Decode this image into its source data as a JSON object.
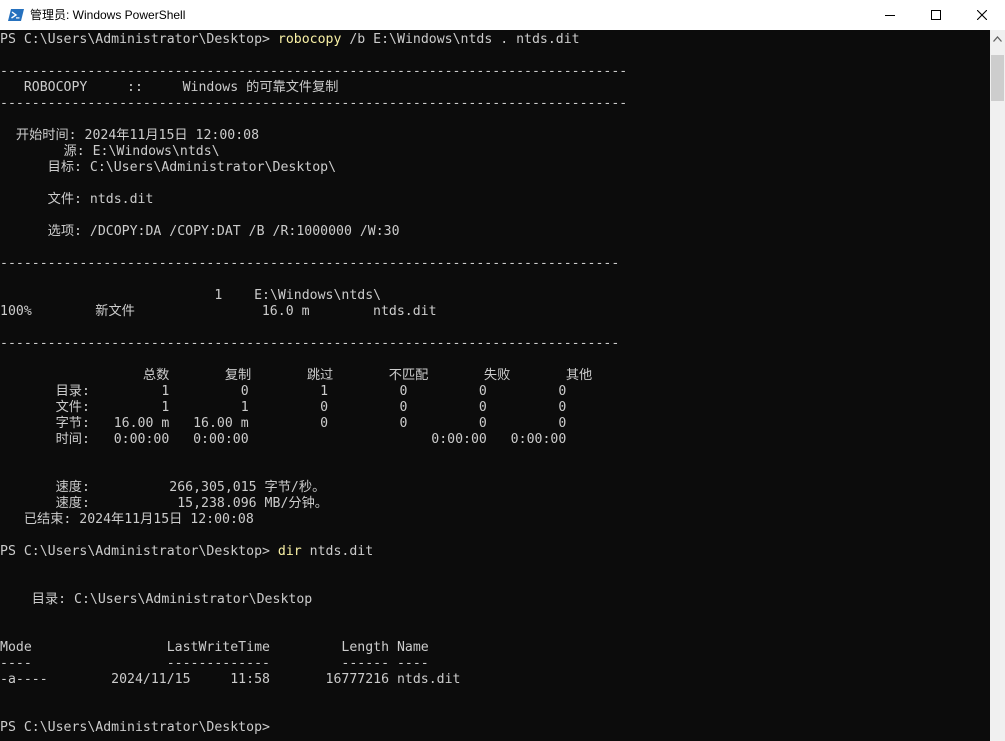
{
  "window": {
    "title": "管理员: Windows PowerShell"
  },
  "icons": {
    "app": "powershell-icon",
    "minimize": "minimize-icon",
    "maximize": "maximize-icon",
    "close": "close-icon",
    "scroll_up": "chevron-up-icon"
  },
  "colors": {
    "console_bg": "#0c0c0c",
    "console_text": "#cccccc",
    "command_text": "#f9f1a5",
    "powershell_blue": "#012456"
  },
  "console": {
    "lines": [
      {
        "prompt": "PS C:\\Users\\Administrator\\Desktop> ",
        "cmd": "robocopy",
        "rest": " /b E:\\Windows\\ntds . ntds.dit"
      },
      {
        "text": ""
      },
      {
        "text": "-------------------------------------------------------------------------------"
      },
      {
        "text": "   ROBOCOPY     ::     Windows 的可靠文件复制"
      },
      {
        "text": "-------------------------------------------------------------------------------"
      },
      {
        "text": ""
      },
      {
        "text": "  开始时间: 2024年11月15日 12:00:08"
      },
      {
        "text": "        源: E:\\Windows\\ntds\\"
      },
      {
        "text": "      目标: C:\\Users\\Administrator\\Desktop\\"
      },
      {
        "text": ""
      },
      {
        "text": "      文件: ntds.dit"
      },
      {
        "text": ""
      },
      {
        "text": "      选项: /DCOPY:DA /COPY:DAT /B /R:1000000 /W:30"
      },
      {
        "text": ""
      },
      {
        "text": "------------------------------------------------------------------------------"
      },
      {
        "text": ""
      },
      {
        "text": "                           1    E:\\Windows\\ntds\\"
      },
      {
        "text": "100%        新文件                16.0 m        ntds.dit"
      },
      {
        "text": ""
      },
      {
        "text": "------------------------------------------------------------------------------"
      },
      {
        "text": ""
      },
      {
        "text": "                  总数       复制       跳过       不匹配       失败       其他"
      },
      {
        "text": "       目录:         1         0         1         0         0         0"
      },
      {
        "text": "       文件:         1         1         0         0         0         0"
      },
      {
        "text": "       字节:   16.00 m   16.00 m         0         0         0         0"
      },
      {
        "text": "       时间:   0:00:00   0:00:00                       0:00:00   0:00:00"
      },
      {
        "text": ""
      },
      {
        "text": ""
      },
      {
        "text": "       速度:          266,305,015 字节/秒。"
      },
      {
        "text": "       速度:           15,238.096 MB/分钟。"
      },
      {
        "text": "   已结束: 2024年11月15日 12:00:08"
      },
      {
        "text": ""
      },
      {
        "prompt": "PS C:\\Users\\Administrator\\Desktop> ",
        "cmd": "dir",
        "rest": " ntds.dit"
      },
      {
        "text": ""
      },
      {
        "text": ""
      },
      {
        "text": "    目录: C:\\Users\\Administrator\\Desktop"
      },
      {
        "text": ""
      },
      {
        "text": ""
      },
      {
        "text": "Mode                 LastWriteTime         Length Name"
      },
      {
        "text": "----                 -------------         ------ ----"
      },
      {
        "text": "-a----        2024/11/15     11:58       16777216 ntds.dit"
      },
      {
        "text": ""
      },
      {
        "text": ""
      },
      {
        "text": "PS C:\\Users\\Administrator\\Desktop> "
      }
    ]
  }
}
